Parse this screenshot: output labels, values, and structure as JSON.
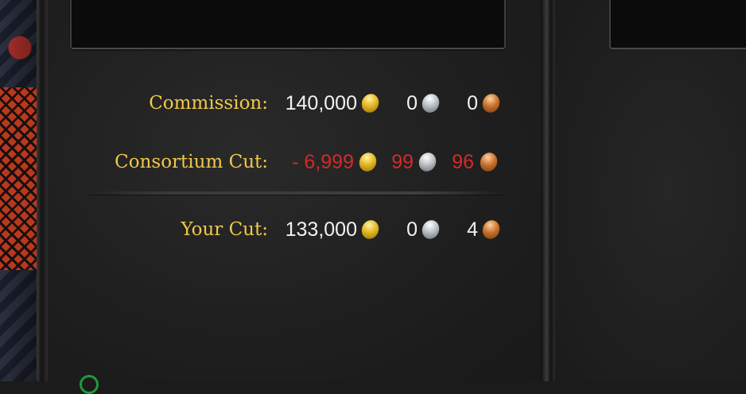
{
  "rows": [
    {
      "label": "Commission:",
      "gold": "140,000",
      "silver": "0",
      "copper": "0",
      "negative": false
    },
    {
      "label": "Consortium Cut:",
      "gold": "- 6,999",
      "silver": "99",
      "copper": "96",
      "negative": true
    },
    {
      "label": "Your Cut:",
      "gold": "133,000",
      "silver": "0",
      "copper": "4",
      "negative": false
    }
  ],
  "colors": {
    "label": "#f0c84a",
    "value": "#f2f2f2",
    "negative": "#d42a2a"
  },
  "icons": [
    "gold-coin-icon",
    "silver-coin-icon",
    "copper-coin-icon"
  ]
}
